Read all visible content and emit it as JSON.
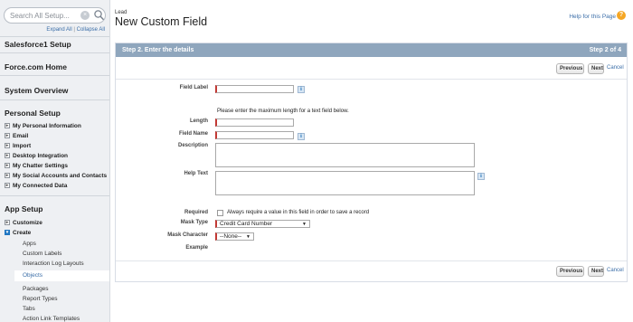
{
  "search": {
    "placeholder": "Search All Setup..."
  },
  "sidebar": {
    "expand_all": "Expand All",
    "separator": "|",
    "collapse_all": "Collapse All",
    "sections": [
      "Salesforce1 Setup",
      "Force.com Home",
      "System Overview"
    ],
    "personal_setup": {
      "title": "Personal Setup",
      "items": [
        "My Personal Information",
        "Email",
        "Import",
        "Desktop Integration",
        "My Chatter Settings",
        "My Social Accounts and Contacts",
        "My Connected Data"
      ]
    },
    "app_setup": {
      "title": "App Setup",
      "items": [
        "Customize",
        "Create"
      ],
      "create_children": [
        "Apps",
        "Custom Labels",
        "Interaction Log Layouts",
        "Objects",
        "Packages",
        "Report Types",
        "Tabs",
        "Action Link Templates"
      ],
      "selected": "Objects"
    }
  },
  "header": {
    "breadcrumb": "Lead",
    "title": "New Custom Field",
    "help_link": "Help for this Page",
    "help_icon_glyph": "?"
  },
  "step": {
    "title": "Step 2. Enter the details",
    "count": "Step 2 of 4"
  },
  "buttons": {
    "previous": "Previous",
    "next": "Next",
    "cancel": "Cancel"
  },
  "form": {
    "field_label": "Field Label",
    "length_note": "Please enter the maximum length for a text field below.",
    "length": "Length",
    "field_name": "Field Name",
    "description": "Description",
    "help_text": "Help Text",
    "required": "Required",
    "required_option": "Always require a value in this field in order to save a record",
    "mask_type": "Mask Type",
    "mask_type_value": "Credit Card Number",
    "mask_character": "Mask Character",
    "mask_character_value": "--None--",
    "example": "Example",
    "info_glyph": "i"
  },
  "colors": {
    "step_header": "#8fa6bd",
    "required_marker": "#c23934",
    "link": "#3b6ea8",
    "help_icon": "#f5a623"
  }
}
